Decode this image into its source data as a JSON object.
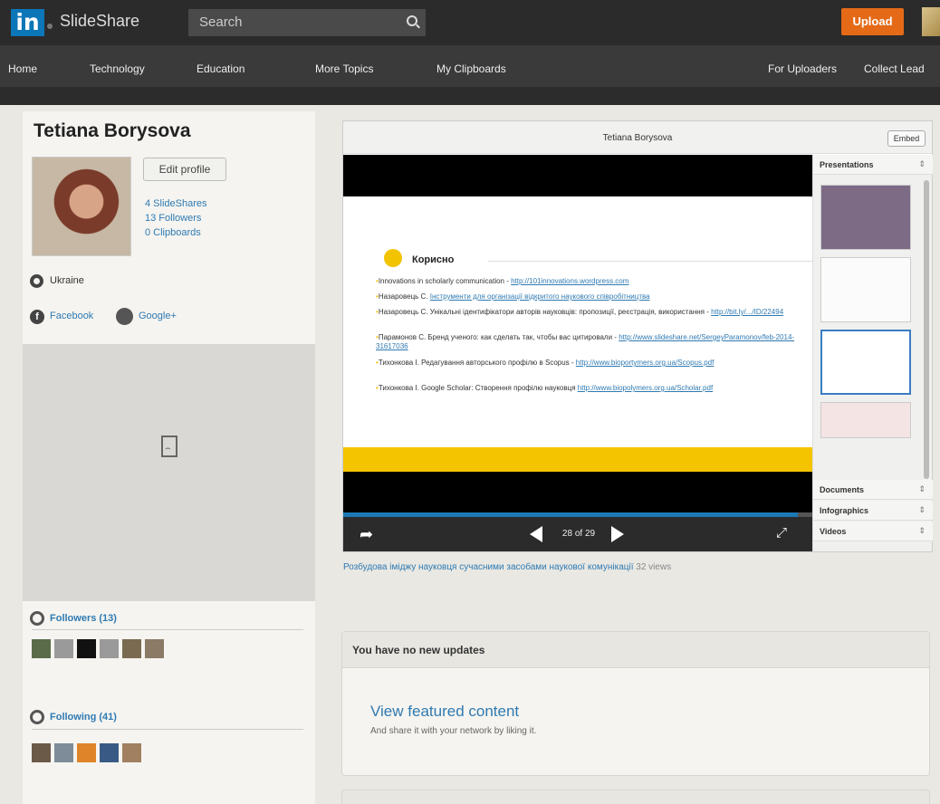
{
  "header": {
    "logo_text": "in",
    "brand": "SlideShare",
    "search_placeholder": "Search",
    "upload_label": "Upload"
  },
  "nav": {
    "items": [
      "Home",
      "Technology",
      "Education",
      "More Topics",
      "My Clipboards"
    ],
    "right_items": [
      "For Uploaders",
      "Collect Lead"
    ]
  },
  "profile": {
    "name": "Tetiana Borysova",
    "edit_label": "Edit profile",
    "stats": [
      "4 SlideShares",
      "13 Followers",
      "0 Clipboards"
    ],
    "location": "Ukraine",
    "facebook_label": "Facebook",
    "google_label": "Google+",
    "followers_title": "Followers (13)",
    "following_title": "Following (41)",
    "follower_thumb_colors": [
      "#5a6b4a",
      "#9a9a9a",
      "#111111",
      "#9a9a9a",
      "#7a6a50",
      "#8a7a66"
    ],
    "following_thumb_colors": [
      "#6b5a48",
      "#7d8c98",
      "#e0842a",
      "#3a5a86",
      "#a08060"
    ]
  },
  "viewer": {
    "title": "Tetiana Borysova",
    "embed_label": "Embed",
    "slide": {
      "heading": "Корисно",
      "lines": [
        {
          "text": "Innovations in scholarly communication - ",
          "link": "http://101innovations.wordpress.com"
        },
        {
          "text": "Назаровець С. ",
          "link": "Інструменти для організації відкритого наукового співробітництва"
        },
        {
          "text": "Назаровець С. Унікальні ідентифікатори авторів науковців: пропозиції, реєстрація, використання - ",
          "link": "http://bit.ly/.../ID/22494"
        },
        {
          "text": "Парамонов С. Бренд ученого: как сделать так, чтобы вас цитировали - ",
          "link": "http://www.slideshare.net/SergeyParamonov/feb-2014-31617036"
        },
        {
          "text": "Тихонкова І. Редагування авторського профілю в Scopus - ",
          "link": "http://www.bioportymers.org.ua/Scopus.pdf"
        },
        {
          "text": "Тихонкова І. Google Scholar: Створення профілю науковця ",
          "link": "http://www.biopolymers.org.ua/Scholar.pdf"
        }
      ]
    },
    "counter": "28 of 29",
    "progress": 0.97,
    "sidebar": {
      "tabs": [
        "Presentations",
        "Documents",
        "Infographics",
        "Videos"
      ]
    }
  },
  "caption": {
    "link": "Розбудова іміджу науковця сучасними засобами наукової комунікації",
    "views": "32 views"
  },
  "updates": {
    "title": "You have no new updates",
    "featured_link": "View featured content",
    "featured_sub": "And share it with your network by liking it."
  },
  "colors": {
    "accent_blue": "#2f7ab2",
    "upload_orange": "#e46a18",
    "slide_yellow": "#f5c400"
  }
}
